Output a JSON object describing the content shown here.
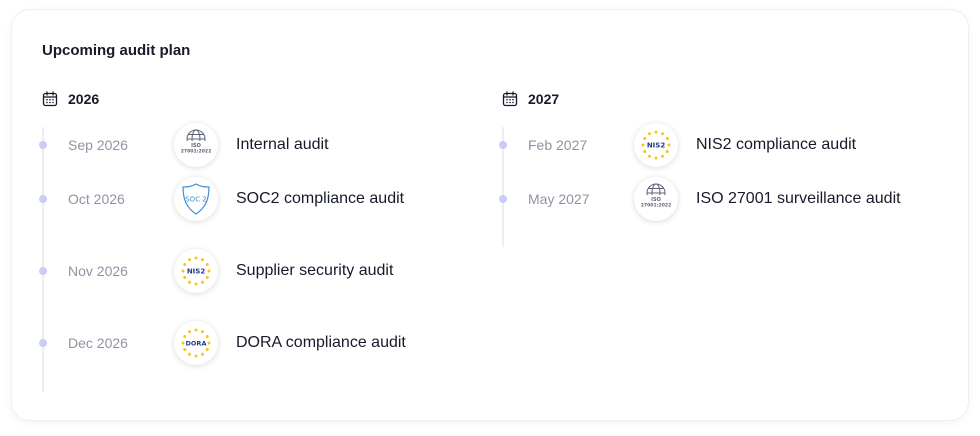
{
  "card": {
    "title": "Upcoming audit plan"
  },
  "years": [
    {
      "year": "2026",
      "icon": "calendar-icon",
      "events": [
        {
          "date": "Sep 2026",
          "name": "Internal audit",
          "badge": "iso-27001-badge-icon",
          "badge_text_top": "ISO",
          "badge_text_bottom": "27001:2022"
        },
        {
          "date": "Oct 2026",
          "name": "SOC2 compliance audit",
          "badge": "soc2-badge-icon",
          "badge_text": "SOC 2"
        },
        {
          "date": "Nov 2026",
          "name": "Supplier security audit",
          "badge": "nis2-badge-icon",
          "badge_text": "NIS2"
        },
        {
          "date": "Dec 2026",
          "name": "DORA compliance audit",
          "badge": "dora-badge-icon",
          "badge_text": "DORA"
        }
      ]
    },
    {
      "year": "2027",
      "icon": "calendar-icon",
      "events": [
        {
          "date": "Feb 2027",
          "name": "NIS2 compliance audit",
          "badge": "nis2-badge-icon",
          "badge_text": "NIS2"
        },
        {
          "date": "May 2027",
          "name": "ISO 27001 surveillance audit",
          "badge": "iso-27001-badge-icon",
          "badge_text_top": "ISO",
          "badge_text_bottom": "27001:2022"
        }
      ]
    }
  ],
  "colors": {
    "title": "#161a2b",
    "date": "#8f94a3",
    "timeline_dot": "#c9cdf5",
    "timeline_line": "#eceef2",
    "eu_star": "#f5c518",
    "eu_text": "#243a8f",
    "soc2_blue": "#3f8fd8",
    "iso_grey": "#5f6475"
  }
}
